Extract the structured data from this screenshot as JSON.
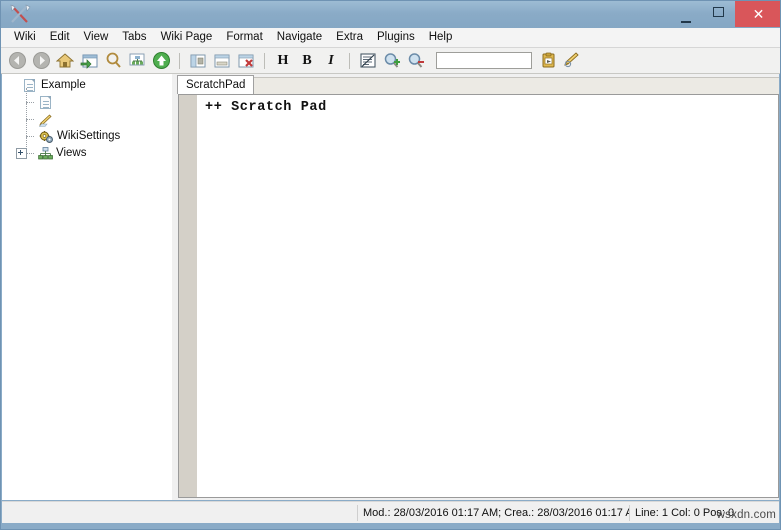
{
  "window": {
    "title": "",
    "app_icon": "wikidpad-pen-icon",
    "controls": {
      "minimize": "minimize-icon",
      "maximize": "maximize-icon",
      "close": "✕"
    },
    "colors": {
      "titlebar": "#8aabc7",
      "close_button": "#d9565a",
      "toolbar_bg": "#f1f1f0",
      "editor_margin": "#d4d0c8"
    }
  },
  "menubar": {
    "items": [
      {
        "label": "Wiki"
      },
      {
        "label": "Edit"
      },
      {
        "label": "View"
      },
      {
        "label": "Tabs"
      },
      {
        "label": "Wiki Page"
      },
      {
        "label": "Format"
      },
      {
        "label": "Navigate"
      },
      {
        "label": "Extra"
      },
      {
        "label": "Plugins"
      },
      {
        "label": "Help"
      }
    ]
  },
  "toolbar": {
    "buttons": [
      {
        "name": "back-icon",
        "tip": "Back"
      },
      {
        "name": "forward-icon",
        "tip": "Forward"
      },
      {
        "name": "home-icon",
        "tip": "Home"
      },
      {
        "name": "open-wiki-icon",
        "tip": "Open Wiki"
      },
      {
        "name": "search-icon",
        "tip": "Search"
      },
      {
        "name": "wiki-tree-icon",
        "tip": "Wiki Tree"
      },
      {
        "name": "up-icon",
        "tip": "Parent"
      },
      {
        "name": "show-tree-panel-icon",
        "tip": "Show Tree"
      },
      {
        "name": "show-editor-icon",
        "tip": "Show Editor"
      },
      {
        "name": "close-tab-icon",
        "tip": "Close Tab"
      },
      {
        "name": "heading-icon",
        "label": "H",
        "tip": "Heading"
      },
      {
        "name": "bold-icon",
        "label": "B",
        "tip": "Bold"
      },
      {
        "name": "italic-icon",
        "label": "I",
        "tip": "Italic"
      },
      {
        "name": "wikiword-icon",
        "tip": "WikiWord"
      },
      {
        "name": "zoom-in-icon",
        "tip": "Zoom In"
      },
      {
        "name": "zoom-out-icon",
        "tip": "Zoom Out"
      },
      {
        "name": "clipboard-catcher-icon",
        "tip": "Clipboard Catcher"
      },
      {
        "name": "quick-note-icon",
        "tip": "Quick Note"
      }
    ],
    "search": {
      "value": "",
      "placeholder": ""
    }
  },
  "tree": {
    "nodes": [
      {
        "label": "Example",
        "icon": "page-icon",
        "depth": 0,
        "expandable": false,
        "expanded": true
      },
      {
        "label": "",
        "icon": "page-icon",
        "depth": 1,
        "expandable": false,
        "expanded": false
      },
      {
        "label": "",
        "icon": "pencil-icon",
        "depth": 1,
        "expandable": false,
        "expanded": false
      },
      {
        "label": "WikiSettings",
        "icon": "gears-icon",
        "depth": 1,
        "expandable": false,
        "expanded": false
      },
      {
        "label": "Views",
        "icon": "views-icon",
        "depth": 1,
        "expandable": true,
        "expanded": false
      }
    ]
  },
  "editor": {
    "tabs": [
      {
        "label": "ScratchPad",
        "active": true
      }
    ],
    "lines": [
      "++ Scratch Pad"
    ]
  },
  "statusbar": {
    "dates": "Mod.: 28/03/2016 01:17 AM; Crea.: 28/03/2016 01:17 A",
    "position": "Line: 1 Col: 0 Pos: 0",
    "watermark": "wsxdn.com"
  }
}
